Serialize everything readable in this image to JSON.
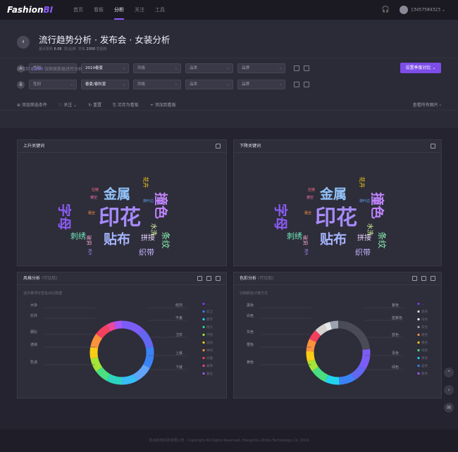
{
  "nav": {
    "logo_main": "Fashi",
    "logo_mark": "on",
    "logo_accent": "BI",
    "items": [
      "首页",
      "看板",
      "分析",
      "关注",
      "工具"
    ],
    "active_index": 2,
    "phone": "13457584323"
  },
  "header": {
    "back_label": "‹",
    "title": "流行趋势分析 · 发布会 · 女装分析",
    "meta": {
      "a_label": "最近更新",
      "a_value": "6.06",
      "b_label": "款/品牌",
      "c_label": "共有",
      "c_value": "2000",
      "d_label": "款图像"
    }
  },
  "filters": {
    "rows": [
      {
        "letter": "A",
        "fields": [
          {
            "value": "性别",
            "filled": false
          },
          {
            "value": "2019春夏",
            "filled": true
          },
          {
            "value": "风格",
            "filled": false
          },
          {
            "value": "品类",
            "filled": false
          },
          {
            "value": "品牌",
            "filled": false
          }
        ]
      },
      {
        "letter": "B",
        "fields": [
          {
            "value": "性别",
            "filled": false
          },
          {
            "value": "春夏/春秋夏",
            "filled": true
          },
          {
            "value": "风格",
            "filled": false
          },
          {
            "value": "品类",
            "filled": false
          },
          {
            "value": "品牌",
            "filled": false
          }
        ]
      }
    ],
    "actions": [
      "⊕ 添加筛选条件",
      "♡ 关注 ⌄",
      "↻ 重置",
      "⎘ 另存为看板",
      "+ 添加到看板"
    ],
    "view_all": "查看所有图片 ›"
  },
  "result": {
    "prefix": "共找到",
    "count": "6,390",
    "suffix": "张图类数据进行分析"
  },
  "compare_button": "设置季度对比 ⌄",
  "wordcloud": {
    "left_title": "上升关键词",
    "right_title": "下降关键词",
    "words": [
      {
        "text": "印花",
        "color": "#a78bfa",
        "size": 30
      },
      {
        "text": "金属",
        "color": "#93c5fd",
        "size": 19
      },
      {
        "text": "贴布",
        "color": "#a5b4fc",
        "size": 19
      },
      {
        "text": "字母",
        "color": "#8b5cf6",
        "size": 19
      },
      {
        "text": "撞色",
        "color": "#c084fc",
        "size": 19
      },
      {
        "text": "刺绣",
        "color": "#6ee7b7",
        "size": 11
      },
      {
        "text": "拼接",
        "color": "#e9d5ff",
        "size": 10
      },
      {
        "text": "条纹",
        "color": "#86efac",
        "size": 12
      },
      {
        "text": "织带",
        "color": "#c4b5fd",
        "size": 11
      },
      {
        "text": "水洗",
        "color": "#d9f99d",
        "size": 9
      },
      {
        "text": "花卉",
        "color": "#facc15",
        "size": 8
      },
      {
        "text": "破洞",
        "color": "#f9a8d4",
        "size": 7
      },
      {
        "text": "拉链",
        "color": "#fb7185",
        "size": 5
      },
      {
        "text": "镂空",
        "color": "#f472b6",
        "size": 5
      },
      {
        "text": "亮片",
        "color": "#a78bfa",
        "size": 5
      },
      {
        "text": "荷叶边",
        "color": "#60a5fa",
        "size": 5
      },
      {
        "text": "蕾丝",
        "color": "#fb923c",
        "size": 5
      }
    ]
  },
  "style_panel": {
    "title": "风格分析",
    "tag": "(可钻取)",
    "note": "选中某项可查看对比数据",
    "left_labels": [
      "大杂",
      "乐井",
      "朋比",
      "波纳",
      "乳液"
    ],
    "right_labels": [
      "结剂",
      "不差",
      "卫衣",
      "上装",
      "下装"
    ],
    "legend": [
      {
        "name": "...",
        "color": "#7c3aed"
      },
      {
        "name": "前卫",
        "color": "#3b82f6"
      },
      {
        "name": "都市",
        "color": "#22d3ee"
      },
      {
        "name": "街头",
        "color": "#34d399"
      },
      {
        "name": "学院",
        "color": "#a3e635"
      },
      {
        "name": "运动",
        "color": "#facc15"
      },
      {
        "name": "休闲",
        "color": "#fb923c"
      },
      {
        "name": "优雅",
        "color": "#f43f5e"
      },
      {
        "name": "极简",
        "color": "#ec4899"
      },
      {
        "name": "复古",
        "color": "#a855f7"
      }
    ],
    "ring": [
      {
        "color": "#7c5cf6",
        "value": 12
      },
      {
        "color": "#6366f1",
        "value": 10
      },
      {
        "color": "#3b82f6",
        "value": 11
      },
      {
        "color": "#60a5fa",
        "value": 9
      },
      {
        "color": "#38bdf8",
        "value": 8
      },
      {
        "color": "#2dd4bf",
        "value": 8
      },
      {
        "color": "#4ade80",
        "value": 7
      },
      {
        "color": "#a3e635",
        "value": 7
      },
      {
        "color": "#facc15",
        "value": 6
      },
      {
        "color": "#fb923c",
        "value": 7
      },
      {
        "color": "#f43f5e",
        "value": 7
      },
      {
        "color": "#ec4899",
        "value": 4
      },
      {
        "color": "#a855f7",
        "value": 4
      }
    ]
  },
  "color_panel": {
    "title": "色彩分析",
    "tag": "(可钻取)",
    "note": "切换颜色计算方式",
    "left_labels": [
      "黑色",
      "白色",
      "灰色",
      "橙色",
      "黄色"
    ],
    "right_labels": [
      "紫色",
      "蓝紫色",
      "蓝色",
      "青色",
      "绿色"
    ],
    "legend": [
      {
        "name": "...",
        "color": "#7c3aed"
      },
      {
        "name": "黑色",
        "color": "#d1d5db"
      },
      {
        "name": "白色",
        "color": "#f3f4f6"
      },
      {
        "name": "灰色",
        "color": "#9ca3af"
      },
      {
        "name": "橙色",
        "color": "#fb923c"
      },
      {
        "name": "黄色",
        "color": "#facc15"
      },
      {
        "name": "绿色",
        "color": "#4ade80"
      },
      {
        "name": "青色",
        "color": "#22d3ee"
      },
      {
        "name": "蓝色",
        "color": "#3b82f6"
      },
      {
        "name": "紫色",
        "color": "#a855f7"
      }
    ],
    "ring": [
      {
        "color": "#4b4a57",
        "value": 22
      },
      {
        "color": "#7c5cf6",
        "value": 10
      },
      {
        "color": "#6366f1",
        "value": 7
      },
      {
        "color": "#3b82f6",
        "value": 8
      },
      {
        "color": "#22d3ee",
        "value": 7
      },
      {
        "color": "#4ade80",
        "value": 8
      },
      {
        "color": "#a3e635",
        "value": 5
      },
      {
        "color": "#facc15",
        "value": 5
      },
      {
        "color": "#fb923c",
        "value": 6
      },
      {
        "color": "#f43f5e",
        "value": 5
      },
      {
        "color": "#d6d3d1",
        "value": 5
      },
      {
        "color": "#e5e7eb",
        "value": 3
      },
      {
        "color": "#9ca3af",
        "value": 4
      }
    ]
  },
  "footer": "杭州织布科技有限公司 · Copyright All Rights Reserved. Hangzhou Zhibu Technology Co. 2019"
}
